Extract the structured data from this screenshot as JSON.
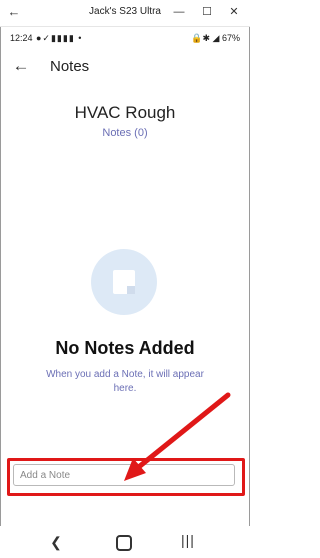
{
  "window": {
    "title": "Jack's S23 Ultra",
    "back_glyph": "←",
    "minimize_glyph": "—",
    "maximize_glyph": "☐",
    "close_glyph": "✕"
  },
  "status_bar": {
    "time": "12:24",
    "notification_icons": "●✓▮▮▮▮ •",
    "battery": "67%",
    "system_icons": "🔒✱ ◢"
  },
  "app_bar": {
    "back_icon": "arrow-left-icon",
    "back_glyph": "←",
    "title": "Notes"
  },
  "header": {
    "job_title": "HVAC Rough",
    "notes_count": "Notes (0)"
  },
  "empty_state": {
    "icon": "note-icon",
    "heading": "No Notes Added",
    "message": "When you add a Note, it will appear here."
  },
  "note_input": {
    "placeholder": "Add a Note",
    "value": ""
  },
  "nav_bar": {
    "back_glyph": "❮",
    "recents_glyph": "|||"
  },
  "colors": {
    "accent": "#6b6fb5",
    "highlight": "#e01818",
    "icon_circle": "#dde9f6"
  }
}
